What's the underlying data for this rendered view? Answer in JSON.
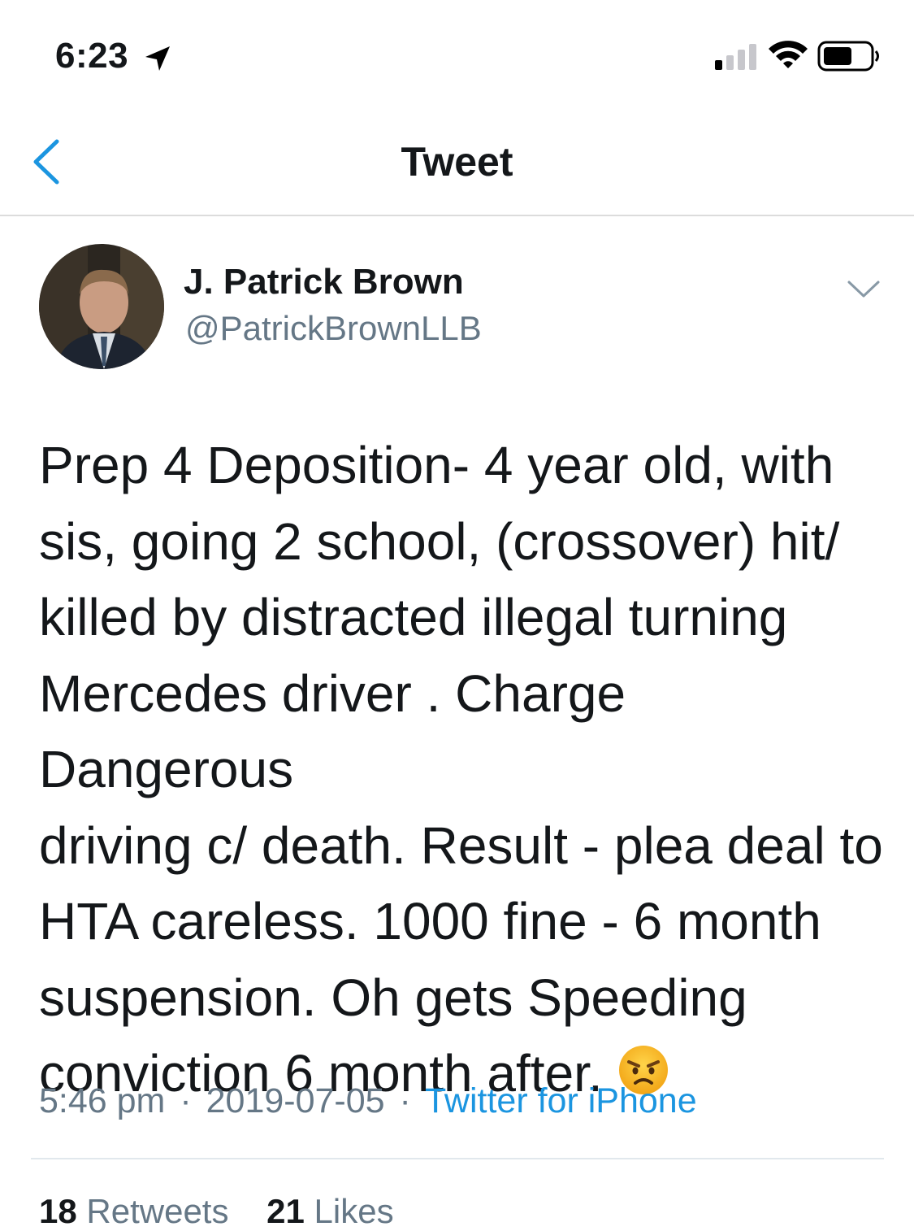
{
  "status_bar": {
    "time": "6:23",
    "icons": [
      "location-arrow-icon",
      "signal-icon",
      "wifi-icon",
      "battery-icon"
    ]
  },
  "nav": {
    "title": "Tweet",
    "back_icon": "chevron-left-icon"
  },
  "tweet": {
    "author_name": "J. Patrick Brown",
    "author_handle": "@PatrickBrownLLB",
    "text": "Prep 4  Deposition- 4 year old, with\nsis, going 2 school, (crossover) hit/\nkilled by distracted illegal turning\nMercedes driver . Charge Dangerous\ndriving c/ death. Result - plea deal to\nHTA careless. 1000 fine - 6 month\nsuspension. Oh gets Speeding\nconviction 6 month after.",
    "emoji": "angry-face-emoji",
    "time": "5:46 pm",
    "date": "2019-07-05",
    "separator": "·",
    "source": "Twitter for iPhone"
  },
  "stats": {
    "retweets_count": "18",
    "retweets_label": "Retweets",
    "likes_count": "21",
    "likes_label": "Likes"
  },
  "colors": {
    "accent": "#1b95e0",
    "secondary_text": "#657786",
    "primary_text": "#14171a"
  }
}
